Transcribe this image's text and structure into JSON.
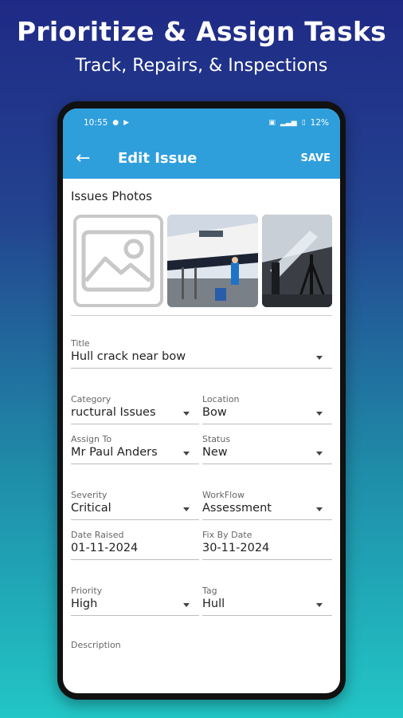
{
  "promo": {
    "title": "Prioritize & Assign Tasks",
    "subtitle": "Track, Repairs, & Inspections"
  },
  "status_bar": {
    "time": "10:55",
    "battery": "12%"
  },
  "app_bar": {
    "title": "Edit Issue",
    "save_label": "SAVE",
    "back_icon": "back-arrow-icon"
  },
  "photos_section": {
    "label": "Issues Photos"
  },
  "form": {
    "title": {
      "label": "Title",
      "value": "Hull crack near bow"
    },
    "category": {
      "label": "Category",
      "value": "ructural Issues"
    },
    "location": {
      "label": "Location",
      "value": "Bow"
    },
    "assign_to": {
      "label": "Assign To",
      "value": "Mr Paul Anders"
    },
    "status": {
      "label": "Status",
      "value": "New"
    },
    "severity": {
      "label": "Severity",
      "value": "Critical"
    },
    "workflow": {
      "label": "WorkFlow",
      "value": "Assessment"
    },
    "date_raised": {
      "label": "Date Raised",
      "value": "01-11-2024"
    },
    "fix_by_date": {
      "label": "Fix By Date",
      "value": "30-11-2024"
    },
    "priority": {
      "label": "Priority",
      "value": "High"
    },
    "tag": {
      "label": "Tag",
      "value": "Hull"
    },
    "description": {
      "label": "Description"
    }
  },
  "colors": {
    "app_bar": "#2f9fdc",
    "background_top": "#1f2a86",
    "background_bottom": "#22c6c6"
  }
}
